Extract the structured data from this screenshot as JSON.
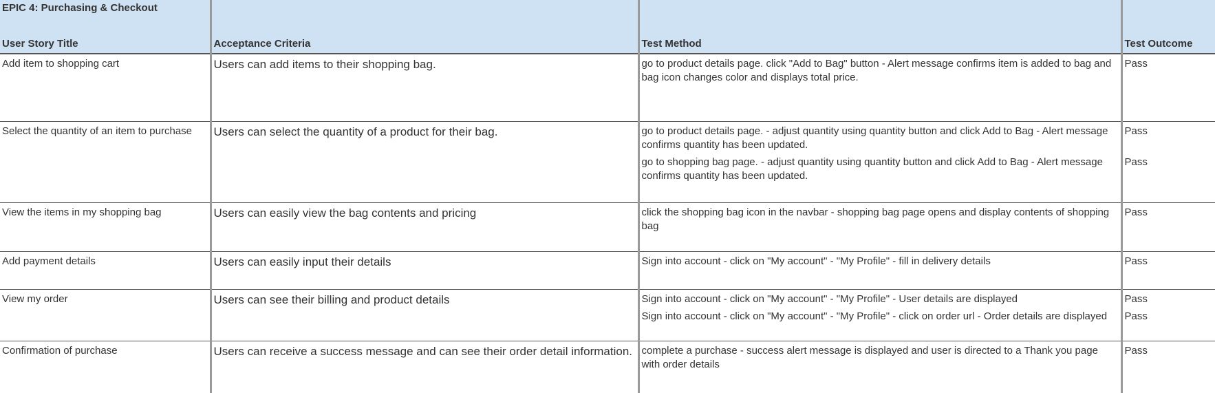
{
  "epic_title": "EPIC 4: Purchasing & Checkout",
  "headers": [
    "User Story Title",
    "Acceptance Criteria",
    "Test Method",
    "Test Outcome"
  ],
  "rows": [
    {
      "title": "Add item to shopping cart",
      "criteria": "Users can add items to their shopping bag.",
      "tests": [
        {
          "method": "go to product details page. click \"Add to Bag\" button - Alert message confirms item is added to bag and bag icon changes color and displays total price.",
          "outcome": "Pass"
        }
      ]
    },
    {
      "title": "Select the quantity of an item to purchase",
      "criteria": "Users can select the quantity of a product for their bag.",
      "tests": [
        {
          "method": "go to product details page. - adjust quantity using quantity button and click Add to Bag - Alert message confirms quantity has been updated.",
          "outcome": "Pass"
        },
        {
          "method": "go to shopping bag page. - adjust quantity using quantity button and click Add to Bag - Alert message confirms quantity has been updated.",
          "outcome": "Pass"
        }
      ]
    },
    {
      "title": "View the items in my shopping bag",
      "criteria": "Users can easily view the bag contents and pricing",
      "tests": [
        {
          "method": "click the shopping bag icon in the navbar - shopping bag page opens and display contents of shopping bag",
          "outcome": "Pass"
        }
      ]
    },
    {
      "title": "Add payment details",
      "criteria": "Users can easily input their details",
      "tests": [
        {
          "method": "Sign into account - click on \"My account\" - \"My Profile\" - fill in delivery details",
          "outcome": "Pass"
        }
      ]
    },
    {
      "title": "View my order",
      "criteria": "Users can see their billing and product details",
      "tests": [
        {
          "method": "Sign into account - click on \"My account\" - \"My Profile\"  - User details are displayed",
          "outcome": "Pass"
        },
        {
          "method": "Sign into account - click on \"My account\" - \"My Profile\"  - click on order url - Order details are displayed",
          "outcome": "Pass"
        }
      ]
    },
    {
      "title": "Confirmation of purchase",
      "criteria": "Users can receive a success message and can see their order detail information.",
      "tests": [
        {
          "method": "complete a purchase - success alert message is displayed and user is directed to a Thank you page with order details",
          "outcome": "Pass"
        }
      ]
    }
  ]
}
